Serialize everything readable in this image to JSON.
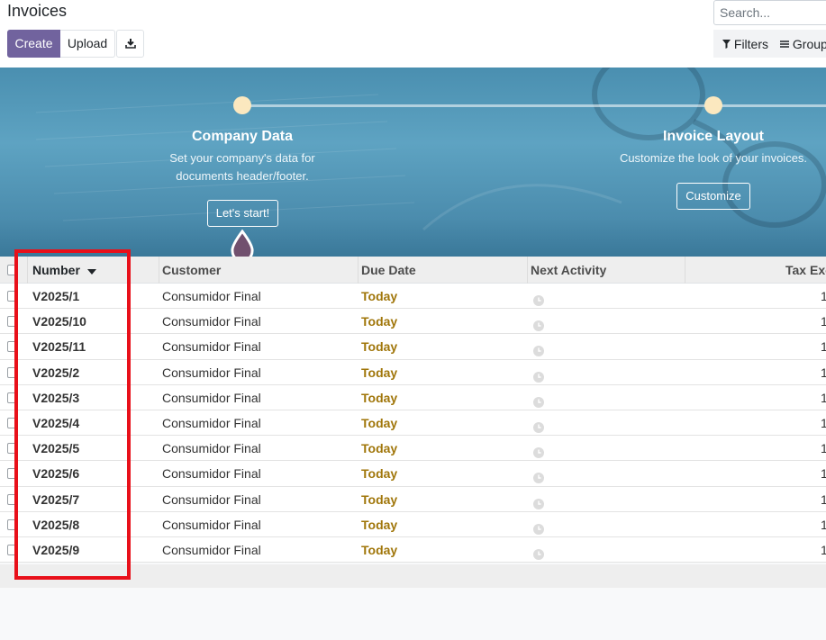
{
  "page": {
    "title": "Invoices"
  },
  "toolbar": {
    "create_label": "Create",
    "upload_label": "Upload",
    "download_icon": "download-icon"
  },
  "search": {
    "placeholder": "Search..."
  },
  "filters": {
    "filters_label": "Filters",
    "groupby_label": "Group"
  },
  "banner": {
    "steps": [
      {
        "title": "Company Data",
        "desc_line1": "Set your company's data for",
        "desc_line2": "documents header/footer.",
        "button": "Let's start!"
      },
      {
        "title": "Invoice Layout",
        "desc_line1": "Customize the look of your invoices.",
        "button": "Customize"
      }
    ]
  },
  "table": {
    "columns": {
      "number": "Number",
      "customer": "Customer",
      "due_date": "Due Date",
      "next_activity": "Next Activity",
      "tax_excluded": "Tax Exc"
    },
    "rows": [
      {
        "number": "V2025/1",
        "customer": "Consumidor Final",
        "due": "Today",
        "tax": "1"
      },
      {
        "number": "V2025/10",
        "customer": "Consumidor Final",
        "due": "Today",
        "tax": "1"
      },
      {
        "number": "V2025/11",
        "customer": "Consumidor Final",
        "due": "Today",
        "tax": "1"
      },
      {
        "number": "V2025/2",
        "customer": "Consumidor Final",
        "due": "Today",
        "tax": "1"
      },
      {
        "number": "V2025/3",
        "customer": "Consumidor Final",
        "due": "Today",
        "tax": "1"
      },
      {
        "number": "V2025/4",
        "customer": "Consumidor Final",
        "due": "Today",
        "tax": "1"
      },
      {
        "number": "V2025/5",
        "customer": "Consumidor Final",
        "due": "Today",
        "tax": "1"
      },
      {
        "number": "V2025/6",
        "customer": "Consumidor Final",
        "due": "Today",
        "tax": "1"
      },
      {
        "number": "V2025/7",
        "customer": "Consumidor Final",
        "due": "Today",
        "tax": "1"
      },
      {
        "number": "V2025/8",
        "customer": "Consumidor Final",
        "due": "Today",
        "tax": "1"
      },
      {
        "number": "V2025/9",
        "customer": "Consumidor Final",
        "due": "Today",
        "tax": "1"
      }
    ]
  },
  "colors": {
    "primary": "#71639e",
    "due_today": "#a0760a",
    "highlight": "#e8101a"
  }
}
